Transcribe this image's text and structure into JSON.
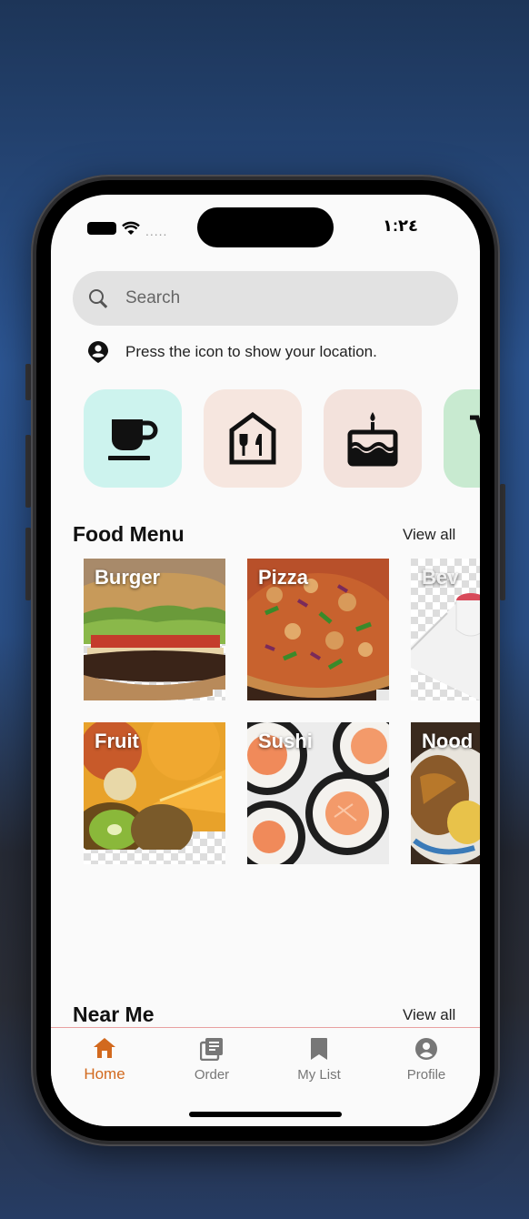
{
  "status": {
    "time": "١:٢٤"
  },
  "search": {
    "placeholder": "Search"
  },
  "location": {
    "text": "Press the icon to show your location."
  },
  "categories": [
    {
      "icon": "coffee-cup-icon",
      "color": "#cdf3ee"
    },
    {
      "icon": "restaurant-icon",
      "color": "#f6e6df"
    },
    {
      "icon": "cake-icon",
      "color": "#f3e2dc"
    },
    {
      "icon": "cart-icon",
      "color": "#c8ead0"
    }
  ],
  "food_menu": {
    "title": "Food Menu",
    "view_all": "View all",
    "items": [
      {
        "label": "Burger"
      },
      {
        "label": "Pizza"
      },
      {
        "label": "Bev"
      },
      {
        "label": "Fruit"
      },
      {
        "label": "Sushi"
      },
      {
        "label": "Nood"
      }
    ]
  },
  "near_me": {
    "title": "Near Me",
    "view_all": "View all"
  },
  "nav": {
    "active_color": "#d2691e",
    "inactive_color": "#777777",
    "items": [
      {
        "label": "Home",
        "icon": "home-icon",
        "active": true
      },
      {
        "label": "Order",
        "icon": "order-list-icon",
        "active": false
      },
      {
        "label": "My List",
        "icon": "bookmark-icon",
        "active": false
      },
      {
        "label": "Profile",
        "icon": "profile-icon",
        "active": false
      }
    ]
  }
}
